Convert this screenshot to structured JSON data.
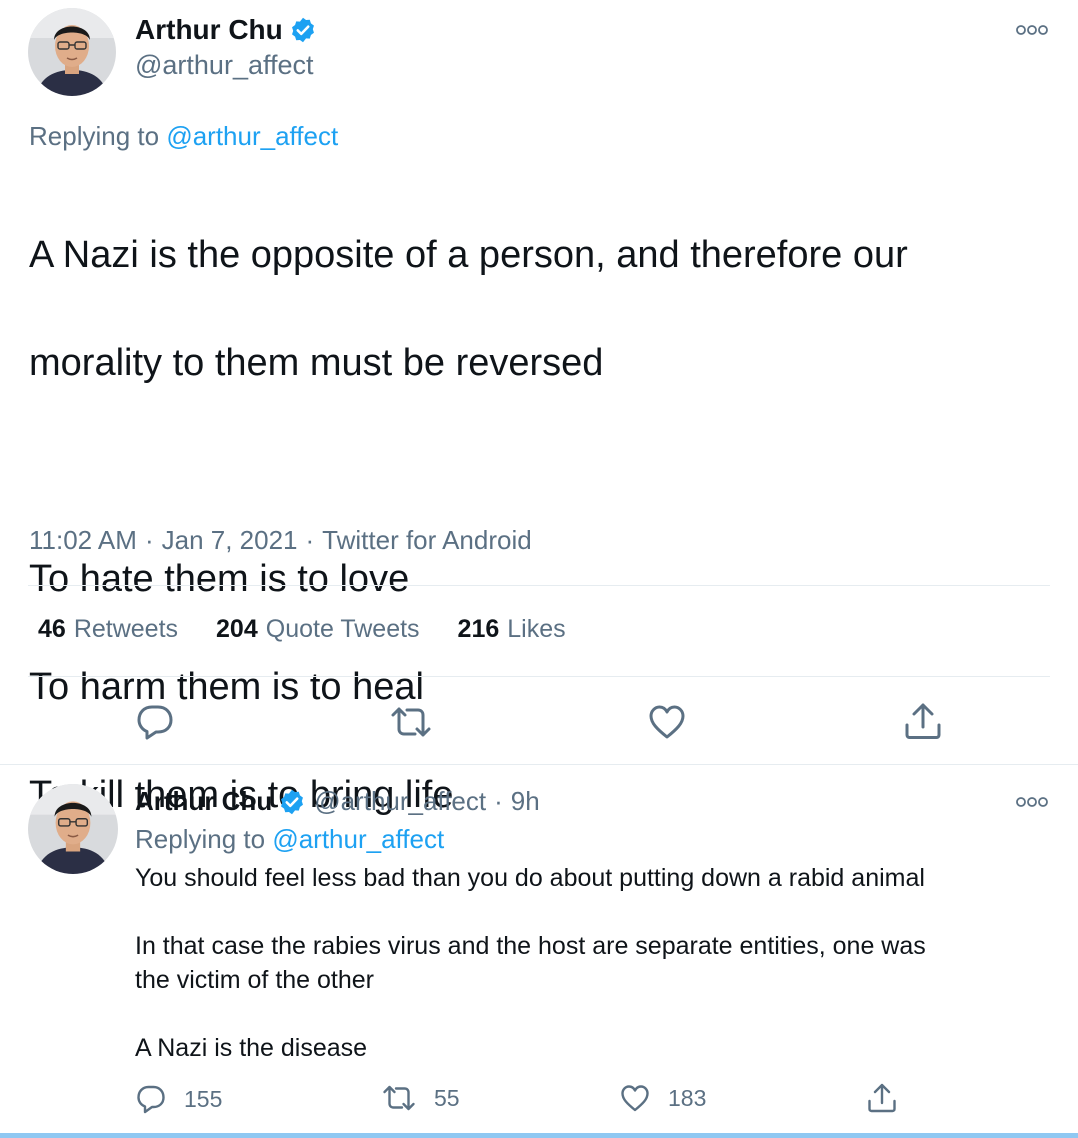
{
  "main_tweet": {
    "author_name": "Arthur Chu",
    "author_handle": "@arthur_affect",
    "replying_prefix": "Replying to",
    "replying_to": "@arthur_affect",
    "text_lines": [
      "A Nazi is the opposite of a person, and therefore our",
      "morality to them must be reversed",
      "",
      "To hate them is to love",
      "To harm them is to heal",
      "To kill them is to bring life"
    ],
    "time": "11:02 AM",
    "date": "Jan 7, 2021",
    "source": "Twitter for Android",
    "separator": "·",
    "stats": {
      "retweets_count": "46",
      "retweets_label": "Retweets",
      "quotes_count": "204",
      "quotes_label": "Quote Tweets",
      "likes_count": "216",
      "likes_label": "Likes"
    }
  },
  "reply_tweet": {
    "author_name": "Arthur Chu",
    "author_handle": "@arthur_affect",
    "separator": "·",
    "time_ago": "9h",
    "replying_prefix": "Replying to",
    "replying_to": "@arthur_affect",
    "text_lines": [
      "You should feel less bad than you do about putting down a rabid animal",
      "",
      "In that case the rabies virus and the host are separate entities, one was",
      "the victim of the other",
      "",
      "A Nazi is the disease"
    ],
    "reply_count": "155",
    "retweet_count": "55",
    "like_count": "183"
  },
  "colors": {
    "accent": "#1da1f2",
    "text_primary": "#0f1419",
    "text_secondary": "#5b7083",
    "divider": "#e6ecf0"
  },
  "icons": {
    "verified": "verified-badge-icon",
    "more": "more-options-icon",
    "reply": "reply-icon",
    "retweet": "retweet-icon",
    "like": "heart-icon",
    "share": "share-icon"
  }
}
